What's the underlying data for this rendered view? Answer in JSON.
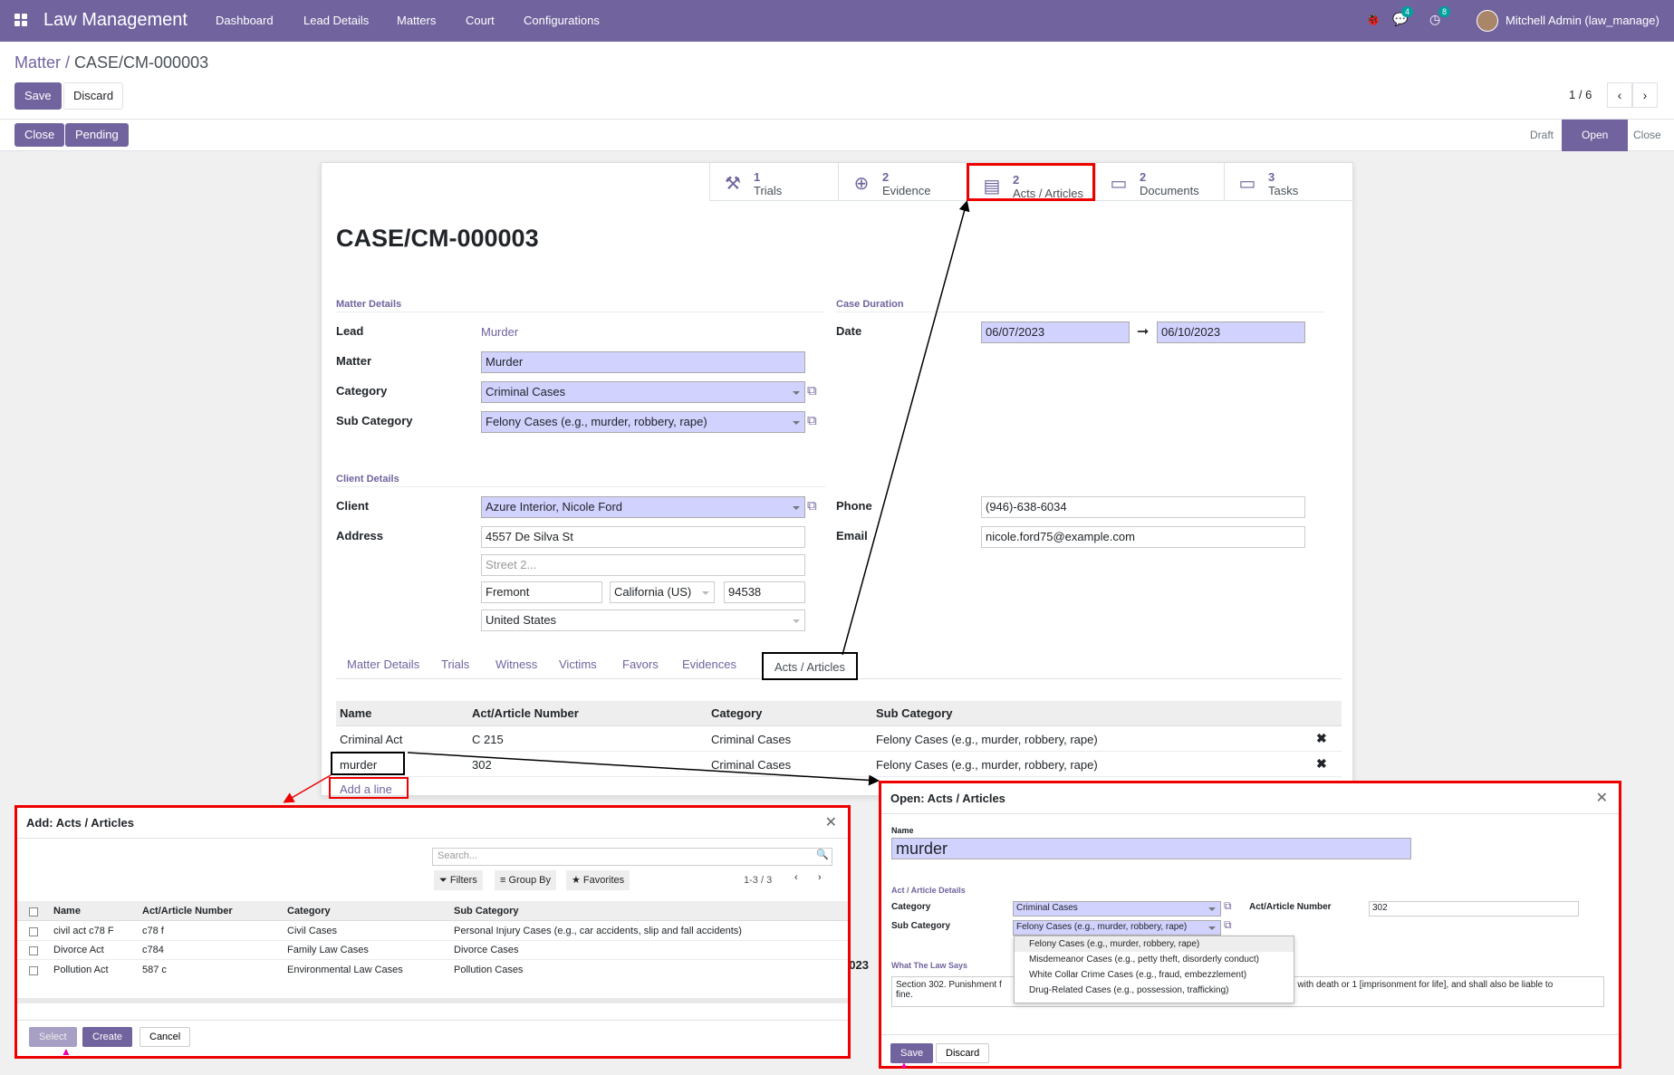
{
  "nav": {
    "brand": "Law Management",
    "menus": [
      "Dashboard",
      "Lead Details",
      "Matters",
      "Court",
      "Configurations"
    ],
    "chat_badge": "4",
    "activity_badge": "8",
    "user": "Mitchell Admin (law_manage)"
  },
  "breadcrumb": {
    "parent": "Matter",
    "current": "CASE/CM-000003"
  },
  "actions": {
    "save": "Save",
    "discard": "Discard",
    "close": "Close",
    "pending": "Pending"
  },
  "pager": {
    "value": "1 / 6"
  },
  "stages": [
    "Draft",
    "Open",
    "Close"
  ],
  "smart_buttons": [
    {
      "n": "1",
      "label": "Trials"
    },
    {
      "n": "2",
      "label": "Evidence"
    },
    {
      "n": "2",
      "label": "Acts / Articles"
    },
    {
      "n": "2",
      "label": "Documents"
    },
    {
      "n": "3",
      "label": "Tasks"
    }
  ],
  "record": {
    "title": "CASE/CM-000003",
    "matter_details": {
      "section": "Matter Details",
      "lead_label": "Lead",
      "lead": "Murder",
      "matter_label": "Matter",
      "matter": "Murder",
      "category_label": "Category",
      "category": "Criminal Cases",
      "subcategory_label": "Sub Category",
      "subcategory": "Felony Cases (e.g., murder, robbery, rape)"
    },
    "duration": {
      "section": "Case Duration",
      "date_label": "Date",
      "start": "06/07/2023",
      "end": "06/10/2023"
    },
    "client": {
      "section": "Client Details",
      "client_label": "Client",
      "client": "Azure Interior, Nicole Ford",
      "address_label": "Address",
      "street": "4557 De Silva St",
      "street2_ph": "Street 2...",
      "city": "Fremont",
      "state": "California (US)",
      "zip": "94538",
      "country": "United States",
      "phone_label": "Phone",
      "phone": "(946)-638-6034",
      "email_label": "Email",
      "email": "nicole.ford75@example.com"
    }
  },
  "tabs": [
    "Matter Details",
    "Trials",
    "Witness",
    "Victims",
    "Favors",
    "Evidences",
    "Acts / Articles"
  ],
  "acts_table": {
    "headers": [
      "Name",
      "Act/Article Number",
      "Category",
      "Sub Category"
    ],
    "rows": [
      {
        "name": "Criminal Act",
        "num": "C 215",
        "cat": "Criminal Cases",
        "sub": "Felony Cases (e.g., murder, robbery, rape)"
      },
      {
        "name": "murder",
        "num": "302",
        "cat": "Criminal Cases",
        "sub": "Felony Cases (e.g., murder, robbery, rape)"
      }
    ],
    "add_line": "Add a line"
  },
  "add_dialog": {
    "title": "Add: Acts / Articles",
    "search_ph": "Search...",
    "filters": "Filters",
    "group_by": "Group By",
    "favorites": "Favorites",
    "pager": "1-3 / 3",
    "headers": [
      "Name",
      "Act/Article Number",
      "Category",
      "Sub Category"
    ],
    "rows": [
      {
        "name": "civil act c78 F",
        "num": "c78 f",
        "cat": "Civil Cases",
        "sub": "Personal Injury Cases (e.g., car accidents, slip and fall accidents)"
      },
      {
        "name": "Divorce Act",
        "num": "c784",
        "cat": "Family Law Cases",
        "sub": "Divorce Cases"
      },
      {
        "name": "Pollution Act",
        "num": "587 c",
        "cat": "Environmental Law Cases",
        "sub": "Pollution Cases"
      }
    ],
    "select": "Select",
    "create": "Create",
    "cancel": "Cancel"
  },
  "open_dialog": {
    "title": "Open: Acts / Articles",
    "name_label": "Name",
    "name": "murder",
    "section": "Act / Article Details",
    "category_label": "Category",
    "category": "Criminal Cases",
    "subcategory_label": "Sub Category",
    "subcategory": "Felony Cases (e.g., murder, robbery, rape)",
    "num_label": "Act/Article Number",
    "num": "302",
    "law_section": "What The Law Says",
    "law_text_a": "Section 302. Punishment f",
    "law_text_b": "ished with death or 1 [imprisonment for life], and shall also be liable to",
    "law_text_c": "fine.",
    "options": [
      "Felony Cases (e.g., murder, robbery, rape)",
      "Misdemeanor Cases (e.g., petty theft, disorderly conduct)",
      "White Collar Crime Cases (e.g., fraud, embezzlement)",
      "Drug-Related Cases (e.g., possession, trafficking)"
    ],
    "save": "Save",
    "discard": "Discard"
  },
  "behind_text": "2023",
  "colors": {
    "primary": "#71639e",
    "highlight": "#e00000",
    "required": "#d2d2ff"
  }
}
